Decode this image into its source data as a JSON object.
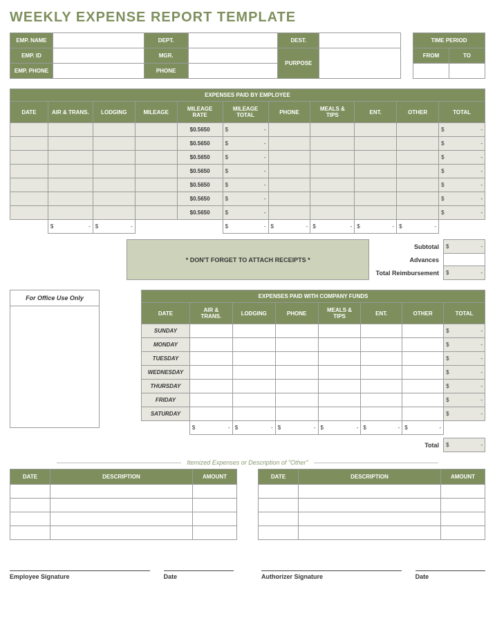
{
  "title": "WEEKLY EXPENSE REPORT TEMPLATE",
  "info": {
    "emp_name": "EMP. NAME",
    "emp_id": "EMP. ID",
    "emp_phone": "EMP. PHONE",
    "dept": "DEPT.",
    "mgr": "MGR.",
    "phone": "PHONE",
    "dest": "DEST.",
    "purpose": "PURPOSE",
    "time_period": "TIME PERIOD",
    "from": "FROM",
    "to": "TO"
  },
  "emp_table": {
    "band": "EXPENSES PAID BY EMPLOYEE",
    "headers": [
      "DATE",
      "AIR & TRANS.",
      "LODGING",
      "MILEAGE",
      "MILEAGE RATE",
      "MILEAGE TOTAL",
      "PHONE",
      "MEALS & TIPS",
      "ENT.",
      "OTHER",
      "TOTAL"
    ],
    "mileage_rate": "$0.5650",
    "dash": "-",
    "dollar": "$",
    "rows": 7
  },
  "summary": {
    "subtotal": "Subtotal",
    "advances": "Advances",
    "total_reimb": "Total Reimbursement",
    "receipts_note": "* DON'T FORGET TO ATTACH RECEIPTS *"
  },
  "office_use": "For Office Use Only",
  "co_table": {
    "band": "EXPENSES PAID WITH COMPANY FUNDS",
    "headers": [
      "DATE",
      "AIR & TRANS.",
      "LODGING",
      "PHONE",
      "MEALS & TIPS",
      "ENT.",
      "OTHER",
      "TOTAL"
    ],
    "days": [
      "SUNDAY",
      "MONDAY",
      "TUESDAY",
      "WEDNESDAY",
      "THURSDAY",
      "FRIDAY",
      "SATURDAY"
    ],
    "total": "Total"
  },
  "itemized": {
    "label": "Itemized Expenses or Description of \"Other\"",
    "headers": [
      "DATE",
      "DESCRIPTION",
      "AMOUNT"
    ],
    "rows": 4
  },
  "sigs": {
    "emp": "Employee Signature",
    "date": "Date",
    "auth": "Authorizer Signature"
  }
}
